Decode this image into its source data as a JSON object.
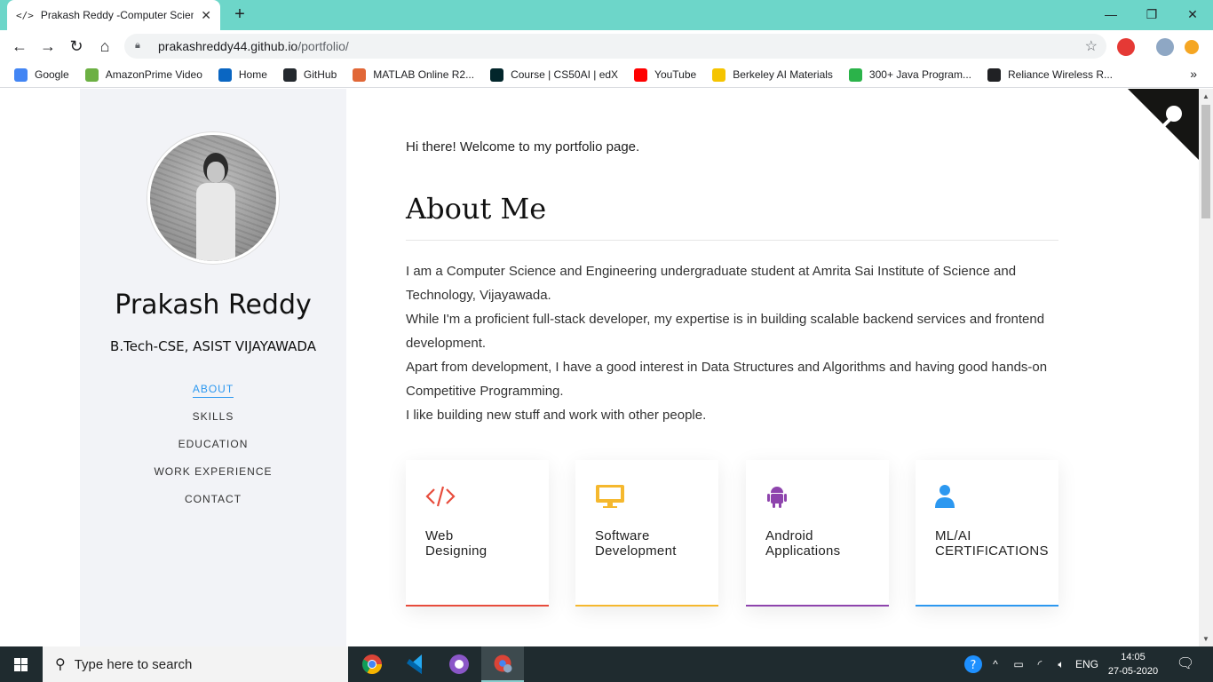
{
  "browser": {
    "tab_icon": "</>",
    "tab_title": "Prakash Reddy -Computer Scienc",
    "url_host": "prakashreddy44.github.io",
    "url_path": "/portfolio/",
    "bookmarks": [
      {
        "label": "Google",
        "icon": "google-icon",
        "color": "#4285f4"
      },
      {
        "label": "AmazonPrime Video",
        "icon": "prime-video-icon",
        "color": "#6cb043"
      },
      {
        "label": "Home",
        "icon": "linkedin-icon",
        "color": "#0a66c2"
      },
      {
        "label": "GitHub",
        "icon": "github-icon",
        "color": "#24292e"
      },
      {
        "label": "MATLAB Online R2...",
        "icon": "matlab-icon",
        "color": "#e16737"
      },
      {
        "label": "Course | CS50AI | edX",
        "icon": "edx-icon",
        "color": "#02262b"
      },
      {
        "label": "YouTube",
        "icon": "youtube-icon",
        "color": "#ff0000"
      },
      {
        "label": "Berkeley AI Materials",
        "icon": "pacman-icon",
        "color": "#f5c400"
      },
      {
        "label": "300+ Java Program...",
        "icon": "java-icon",
        "color": "#2bb34a"
      },
      {
        "label": "Reliance Wireless R...",
        "icon": "globe-icon",
        "color": "#202124"
      }
    ]
  },
  "sidebar": {
    "name": "Prakash Reddy",
    "degree": "B.Tech-CSE, ASIST VIJAYAWADA",
    "nav": [
      "ABOUT",
      "SKILLS",
      "EDUCATION",
      "WORK EXPERIENCE",
      "CONTACT"
    ]
  },
  "main": {
    "welcome": "Hi there! Welcome to my portfolio page.",
    "about_title": "About Me",
    "bio": [
      "I am a Computer Science and Engineering undergraduate student at Amrita Sai Institute of Science and Technology, Vijayawada.",
      "While I'm a proficient full-stack developer, my expertise is in building scalable backend services and frontend development.",
      "Apart from development, I have a good interest in Data Structures and Algorithms and having good hands-on Competitive Programming.",
      "I like building new stuff and work with other people."
    ],
    "cards": [
      {
        "line1": "Web",
        "line2": "Designing",
        "color": "#e74c3c",
        "icon": "code-icon"
      },
      {
        "line1": "Software",
        "line2": "Development",
        "color": "#f5b82e",
        "icon": "monitor-icon"
      },
      {
        "line1": "Android",
        "line2": "Applications",
        "color": "#8e44ad",
        "icon": "android-icon"
      },
      {
        "line1": "ML/AI",
        "line2": "CERTIFICATIONS",
        "color": "#2c98f0",
        "icon": "user-icon"
      }
    ]
  },
  "taskbar": {
    "search_placeholder": "Type here to search",
    "lang": "ENG",
    "time": "14:05",
    "date": "27-05-2020"
  }
}
